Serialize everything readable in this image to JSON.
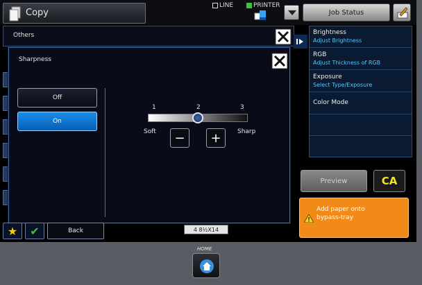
{
  "header": {
    "app_title": "Copy",
    "mode_line": "LINE",
    "mode_printer": "PRINTER",
    "job_status": "Job Status"
  },
  "others_panel": {
    "title": "Others"
  },
  "dialog": {
    "title": "Sharpness",
    "off_label": "Off",
    "on_label": "On",
    "selected": "On",
    "tick_1": "1",
    "tick_2": "2",
    "tick_3": "3",
    "soft_label": "Soft",
    "sharp_label": "Sharp",
    "minus_label": "−",
    "plus_label": "+",
    "slider_value": 2
  },
  "right_menu": [
    {
      "title": "Brightness",
      "subtitle": "Adjust Brightness"
    },
    {
      "title": "RGB",
      "subtitle": "Adjust Thickness of RGB"
    },
    {
      "title": "Exposure",
      "subtitle": "Select Type/Exposure"
    },
    {
      "title": "Color Mode",
      "subtitle": ""
    }
  ],
  "buttons": {
    "preview": "Preview",
    "ca": "CA",
    "back": "Back"
  },
  "alert": {
    "line1": "Add paper onto",
    "line2": "bypass-tray"
  },
  "paper_size": "4 8½X14",
  "home_label": "HOME",
  "colors": {
    "accent_blue": "#1b8de6",
    "alert_orange": "#f28a1a",
    "ca_yellow": "#f7e41c",
    "link_blue": "#56c9ff"
  },
  "icons": [
    "copy-icon",
    "printer-icon",
    "chevron-down-icon",
    "tools-icon",
    "close-icon",
    "warning-icon",
    "star-icon",
    "check-icon",
    "home-icon",
    "expand-arrow-icon"
  ]
}
